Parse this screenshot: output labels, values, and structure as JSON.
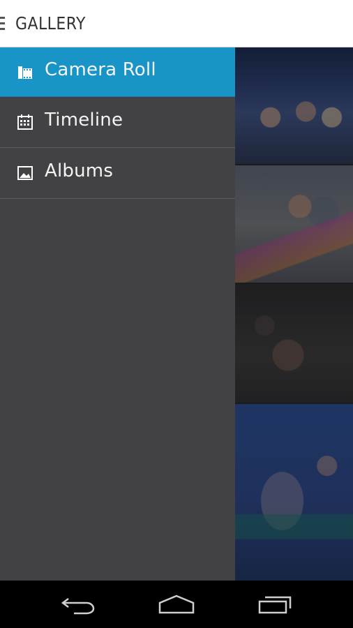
{
  "action_bar": {
    "title": "GALLERY",
    "menu_icon": "hamburger-menu-icon"
  },
  "drawer": {
    "items": [
      {
        "label": "Camera Roll",
        "icon": "camera-roll-icon",
        "active": true
      },
      {
        "label": "Timeline",
        "icon": "calendar-icon",
        "active": false
      },
      {
        "label": "Albums",
        "icon": "image-icon",
        "active": false
      }
    ]
  },
  "system_nav": {
    "back_icon": "back-icon",
    "home_icon": "home-icon",
    "recents_icon": "recent-apps-icon"
  },
  "colors": {
    "accent": "#1994c6",
    "drawer_bg": "#424244",
    "action_bar_bg": "#ffffff",
    "nav_bar_bg": "#000000"
  }
}
